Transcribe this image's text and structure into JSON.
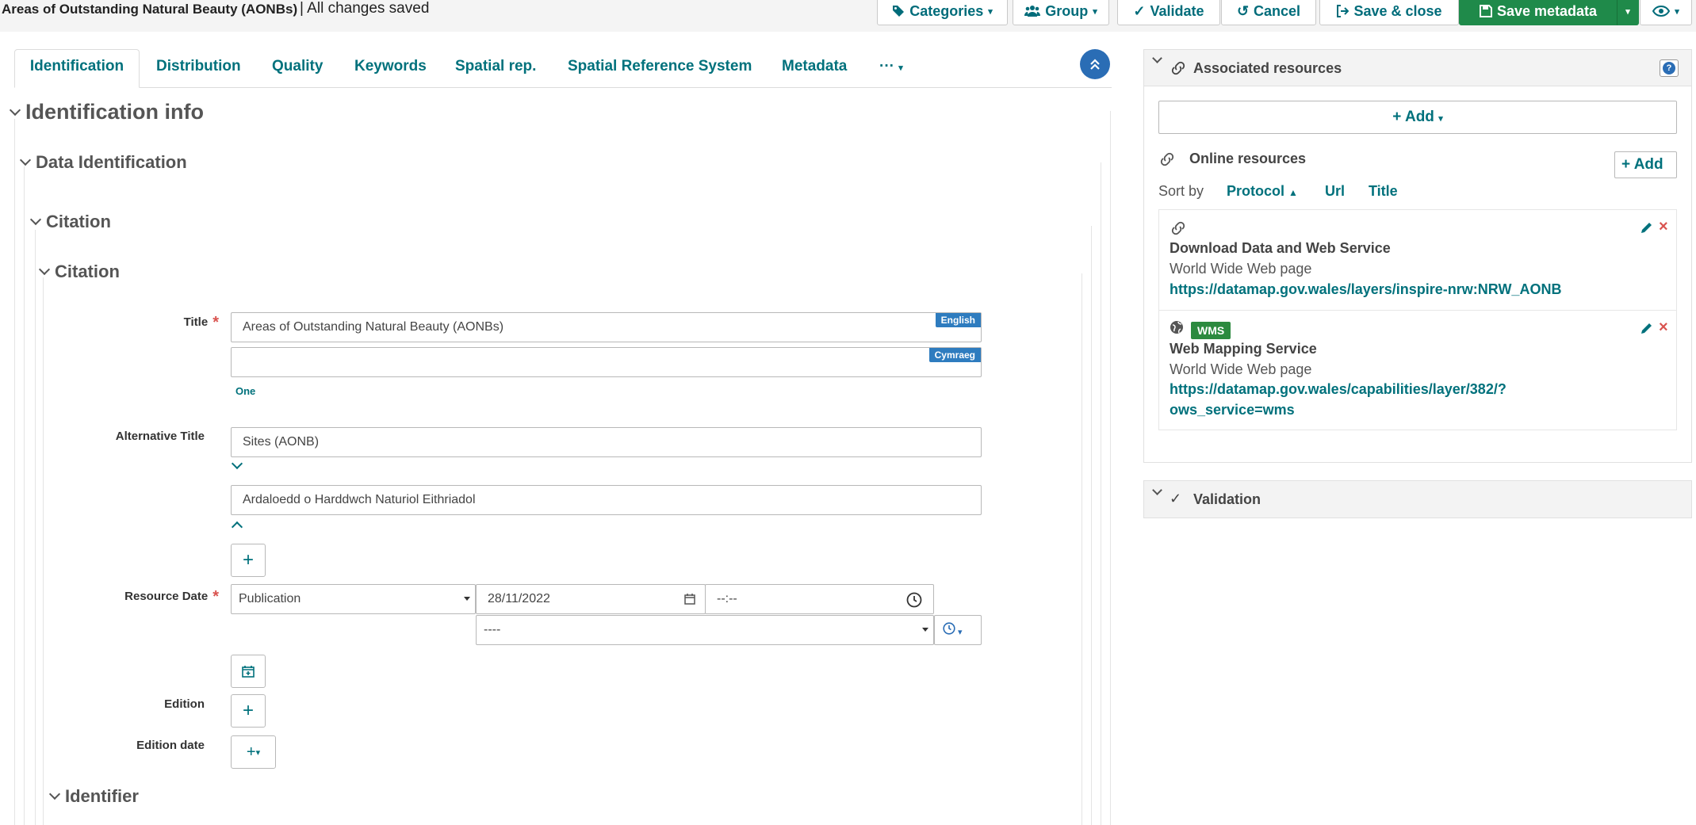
{
  "header": {
    "title": "Areas of Outstanding Natural Beauty (AONBs)",
    "separator": "|",
    "status": "All changes saved",
    "buttons": {
      "categories": "Categories",
      "group": "Group",
      "validate": "Validate",
      "cancel": "Cancel",
      "save_close": "Save & close",
      "save_metadata": "Save metadata"
    }
  },
  "tabs": [
    "Identification",
    "Distribution",
    "Quality",
    "Keywords",
    "Spatial rep.",
    "Spatial Reference System",
    "Metadata",
    "···"
  ],
  "sections": {
    "identification_info": "Identification info",
    "data_identification": "Data Identification",
    "citation_outer": "Citation",
    "citation_inner": "Citation",
    "identifier": "Identifier"
  },
  "form": {
    "title_label": "Title",
    "title_value": "Areas of Outstanding Natural Beauty (AONBs)",
    "title_value_cy": "",
    "lang_en": "English",
    "lang_cy": "Cymraeg",
    "one_link": "One",
    "alt_title_label": "Alternative Title",
    "alt_title_1": "Sites (AONB)",
    "alt_title_2": "Ardaloedd o Harddwch Naturiol Eithriadol",
    "resource_date_label": "Resource Date",
    "date_type": "Publication",
    "date_value": "28/11/2022",
    "time_value": "--:--",
    "timezone_value": "----",
    "edition_label": "Edition",
    "edition_date_label": "Edition date"
  },
  "resources": {
    "panel_title": "Associated resources",
    "help": "?",
    "add_label": "Add",
    "online_resources": "Online resources",
    "online_add": "Add",
    "sort_by": "Sort by",
    "sort_protocol": "Protocol",
    "sort_url": "Url",
    "sort_title": "Title",
    "items": [
      {
        "title": "Download Data and Web Service",
        "type": "World Wide Web page",
        "url": "https://datamap.gov.wales/layers/inspire-nrw:NRW_AONB"
      },
      {
        "badge": "WMS",
        "title": "Web Mapping Service",
        "type": "World Wide Web page",
        "url_line1": "https://datamap.gov.wales/capabilities/layer/382/?",
        "url_line2": "ows_service=wms"
      }
    ]
  },
  "validation": {
    "title": "Validation"
  },
  "colors": {
    "accent": "#00717c",
    "primary_blue": "#2a6db5",
    "save_green": "#1f8a4a",
    "required": "#d9534f"
  },
  "icons": [
    "tag-icon",
    "users-icon",
    "check-icon",
    "undo-icon",
    "sign-out-icon",
    "save-icon",
    "eye-icon",
    "link-icon",
    "globe-icon",
    "pencil-icon",
    "remove-icon",
    "calendar-icon",
    "clock-icon",
    "chevron-up-icon"
  ]
}
